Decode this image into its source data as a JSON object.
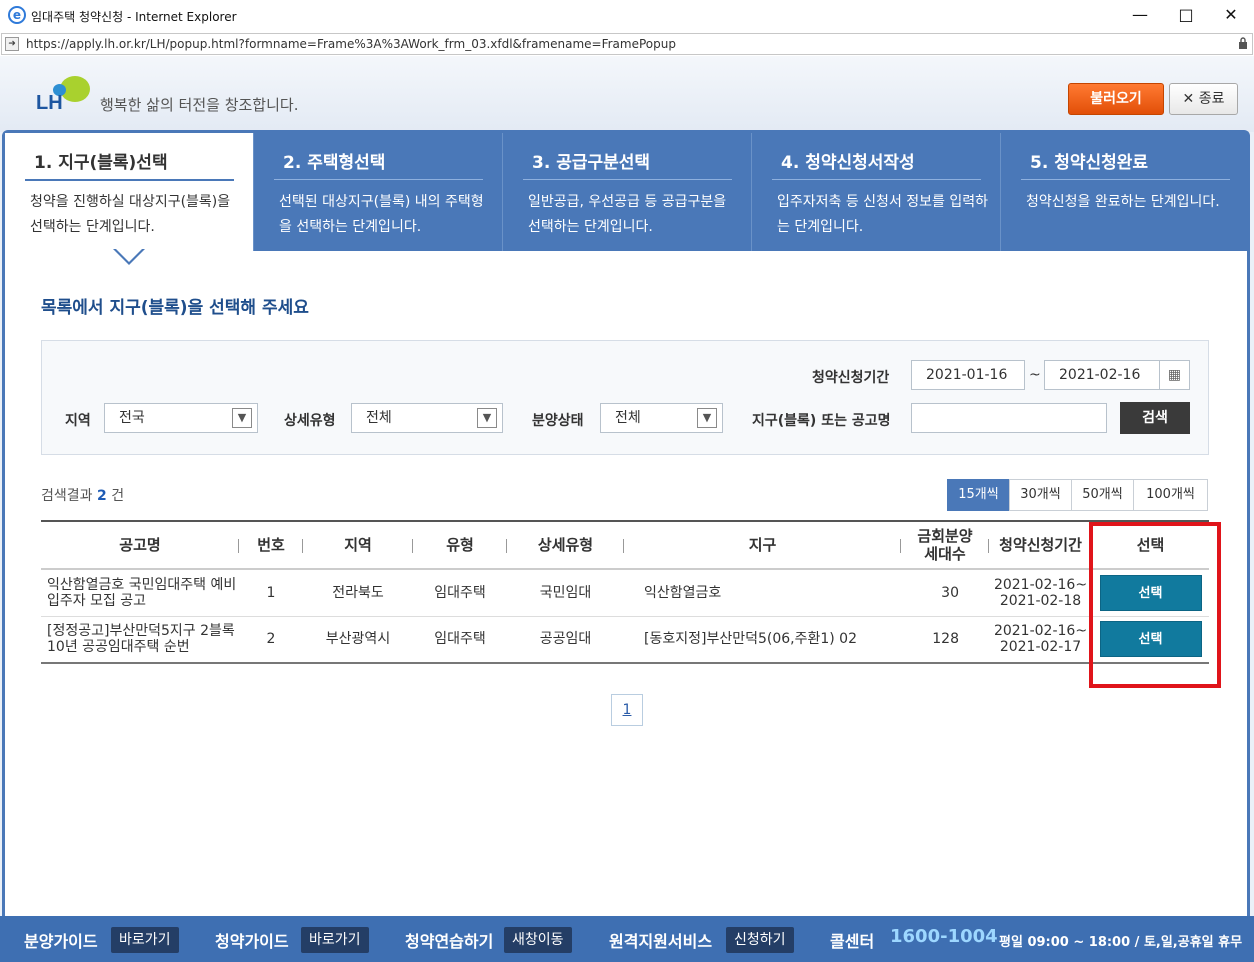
{
  "window": {
    "title": "임대주택 청약신청 - Internet Explorer",
    "url": "https://apply.lh.or.kr/LH/popup.html?formname=Frame%3A%3AWork_frm_03.xfdl&framename=FramePopup"
  },
  "header": {
    "logo_text": "LH",
    "slogan": "행복한 삶의 터전을 창조합니다.",
    "load_button": "불러오기",
    "close_button": "종료"
  },
  "steps": [
    {
      "title": "1. 지구(블록)선택",
      "desc": "청약을 진행하실 대상지구(블록)을 선택하는 단계입니다."
    },
    {
      "title": "2. 주택형선택",
      "desc": "선택된 대상지구(블록) 내의 주택형을 선택하는 단계입니다."
    },
    {
      "title": "3. 공급구분선택",
      "desc": "일반공급, 우선공급 등 공급구분을 선택하는 단계입니다."
    },
    {
      "title": "4. 청약신청서작성",
      "desc": "입주자저축 등 신청서 정보를 입력하는 단계입니다."
    },
    {
      "title": "5. 청약신청완료",
      "desc": "청약신청을 완료하는 단계입니다."
    }
  ],
  "section_title": "목록에서 지구(블록)을 선택해 주세요",
  "filter": {
    "period_label": "청약신청기간",
    "date_from": "2021-01-16",
    "date_sep": "~",
    "date_to": "2021-02-16",
    "region_label": "지역",
    "region_value": "전국",
    "detail_type_label": "상세유형",
    "detail_type_value": "전체",
    "sale_status_label": "분양상태",
    "sale_status_value": "전체",
    "keyword_label": "지구(블록) 또는 공고명",
    "keyword_value": "",
    "search_button": "검색"
  },
  "result": {
    "prefix": "검색결과",
    "count": "2",
    "suffix": "건",
    "page_sizes": [
      "15개씩",
      "30개씩",
      "50개씩",
      "100개씩"
    ],
    "selected_page_size": "15개씩"
  },
  "table": {
    "headers": [
      "공고명",
      "번호",
      "지역",
      "유형",
      "상세유형",
      "지구",
      "금회분양 세대수",
      "청약신청기간",
      "선택"
    ],
    "rows": [
      {
        "name": "익산함열금호 국민임대주택 예비입주자 모집 공고",
        "no": "1",
        "region": "전라북도",
        "type": "임대주택",
        "detail": "국민임대",
        "district": "익산함열금호",
        "units": "30",
        "period": "2021-02-16~ 2021-02-18",
        "select": "선택"
      },
      {
        "name": "[정정공고]부산만덕5지구 2블록 10년 공공임대주택 순번",
        "no": "2",
        "region": "부산광역시",
        "type": "임대주택",
        "detail": "공공임대",
        "district": "[동호지정]부산만덕5(06,주환1) 02",
        "units": "128",
        "period": "2021-02-16~ 2021-02-17",
        "select": "선택"
      }
    ]
  },
  "pagination": {
    "current": "1"
  },
  "footer": {
    "items": [
      {
        "label": "분양가이드",
        "button": "바로가기"
      },
      {
        "label": "청약가이드",
        "button": "바로가기"
      },
      {
        "label": "청약연습하기",
        "button": "새창이동"
      },
      {
        "label": "원격지원서비스",
        "button": "신청하기"
      }
    ],
    "call_label": "콜센터",
    "phone": "1600-1004",
    "hours": "평일 09:00 ~ 18:00 / 토,일,공휴일 휴무"
  },
  "colors": {
    "primary": "#4a78b8",
    "accent": "#e8601c",
    "select_button": "#117a9e",
    "highlight": "#e0141a"
  }
}
